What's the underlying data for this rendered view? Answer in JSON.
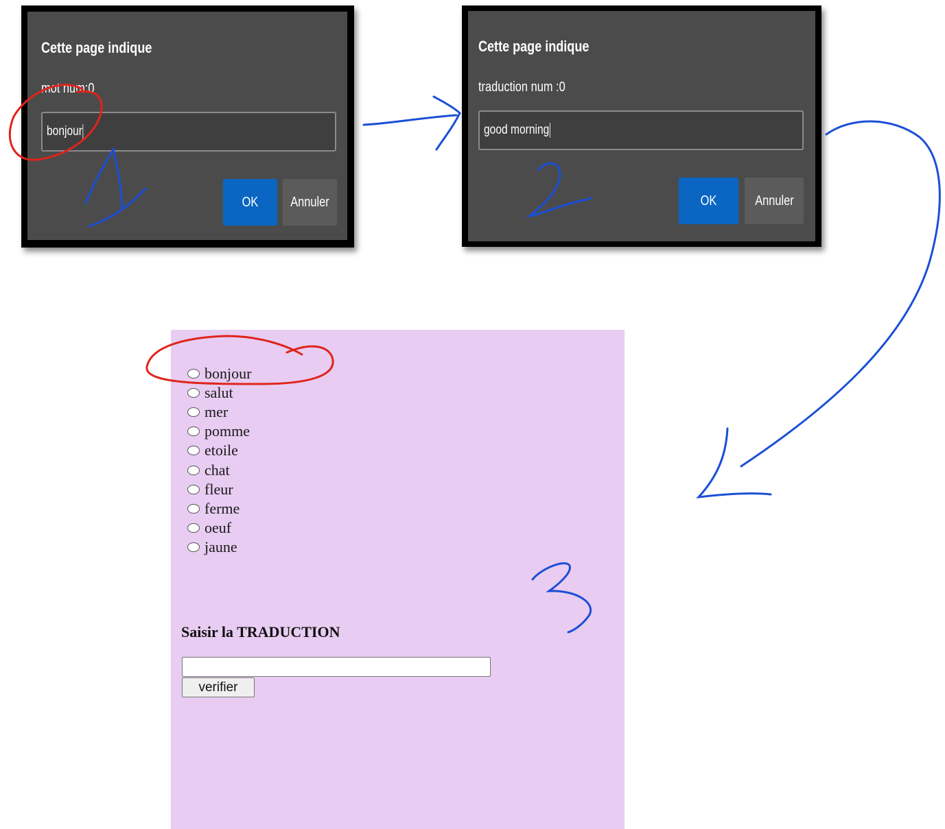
{
  "dialog1": {
    "title": "Cette page indique",
    "message": "mot num:0",
    "input_value": "bonjour",
    "ok_label": "OK",
    "cancel_label": "Annuler"
  },
  "dialog2": {
    "title": "Cette page indique",
    "message": "traduction num :0",
    "input_value": "good morning",
    "ok_label": "OK",
    "cancel_label": "Annuler"
  },
  "page": {
    "words": [
      "bonjour",
      "salut",
      "mer",
      "pomme",
      "etoile",
      "chat",
      "fleur",
      "ferme",
      "oeuf",
      "jaune"
    ],
    "heading": "Saisir la TRADUCTION",
    "input_value": "",
    "verify_label": "verifier",
    "background": "#e8ccf2"
  },
  "colors": {
    "dialog_bg": "#4b4b4b",
    "ok_button": "#0a66c2",
    "cancel_button": "#5b5b5b",
    "annotation_blue": "#1a4fd6",
    "annotation_red": "#e0241b"
  }
}
